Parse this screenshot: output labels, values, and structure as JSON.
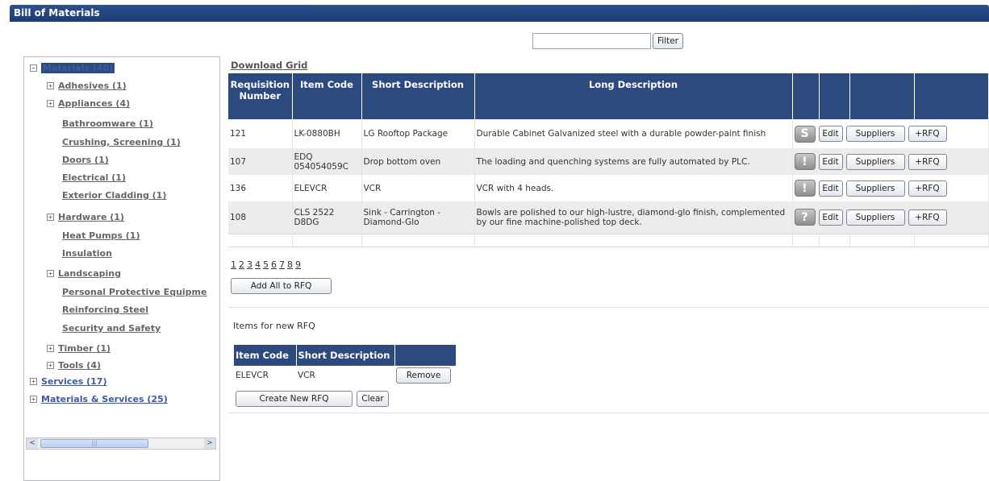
{
  "window": {
    "title": "Bill of Materials"
  },
  "filter": {
    "value": "",
    "button_label": "Filter"
  },
  "tree": {
    "root": {
      "label": "Materials (40)",
      "expander": "−"
    },
    "children": [
      {
        "label": "Adhesives (1)",
        "expander": "+"
      },
      {
        "label": "Appliances (4)",
        "expander": "+"
      },
      {
        "label": "Bathroomware (1)",
        "expander": ""
      },
      {
        "label": "Crushing, Screening (1)",
        "expander": ""
      },
      {
        "label": "Doors (1)",
        "expander": ""
      },
      {
        "label": "Electrical (1)",
        "expander": ""
      },
      {
        "label": "Exterior Cladding (1)",
        "expander": ""
      },
      {
        "label": "Hardware (1)",
        "expander": "+"
      },
      {
        "label": "Heat Pumps (1)",
        "expander": ""
      },
      {
        "label": "Insulation",
        "expander": ""
      },
      {
        "label": "Landscaping",
        "expander": "+"
      },
      {
        "label": "Personal Protective Equipme",
        "expander": ""
      },
      {
        "label": "Reinforcing Steel",
        "expander": ""
      },
      {
        "label": "Security and Safety",
        "expander": ""
      },
      {
        "label": "Timber (1)",
        "expander": "+"
      },
      {
        "label": "Tools (4)",
        "expander": "+"
      }
    ],
    "top_level": [
      {
        "label": "Services (17)",
        "expander": "+"
      },
      {
        "label": "Materials & Services (25)",
        "expander": "+"
      }
    ]
  },
  "grid": {
    "download_label": "Download Grid",
    "headers": {
      "req": "Requisition Number",
      "code": "Item Code",
      "short": "Short Description",
      "long": "Long Description"
    },
    "rows": [
      {
        "req": "121",
        "code": "LK-0880BH",
        "short": "LG Rooftop Package",
        "long": "Durable Cabinet Galvanized steel with a durable powder-paint finish",
        "status_icon": "S",
        "icon_name": "s-status-icon"
      },
      {
        "req": "107",
        "code": "EDQ 054054059C",
        "short": "Drop bottom oven",
        "long": "The loading and quenching systems are fully automated by PLC.",
        "status_icon": "!",
        "icon_name": "exclamation-status-icon"
      },
      {
        "req": "136",
        "code": "ELEVCR",
        "short": "VCR",
        "long": "VCR with 4 heads.",
        "status_icon": "!",
        "icon_name": "exclamation-status-icon"
      },
      {
        "req": "108",
        "code": "CLS 2522 D8DG",
        "short": "Sink - Carrington - Diamond-Glo",
        "long": "Bowls are polished to our high-lustre, diamond-glo finish, complemented by our fine machine-polished top deck.",
        "status_icon": "?",
        "icon_name": "question-status-icon"
      }
    ],
    "action_labels": {
      "edit": "Edit",
      "suppliers": "Suppliers",
      "rfq": "+RFQ"
    },
    "pages": [
      "1",
      "2",
      "3",
      "4",
      "5",
      "6",
      "7",
      "8",
      "9"
    ],
    "add_all_label": "Add All to RFQ"
  },
  "rfq": {
    "heading": "Items for new RFQ",
    "headers": {
      "code": "Item Code",
      "short": "Short Description"
    },
    "rows": [
      {
        "code": "ELEVCR",
        "short": "VCR",
        "remove_label": "Remove"
      }
    ],
    "create_label": "Create New RFQ",
    "clear_label": "Clear"
  },
  "scroll": {
    "left_arrow": "<",
    "right_arrow": ">",
    "thumb_grip": "|||"
  }
}
